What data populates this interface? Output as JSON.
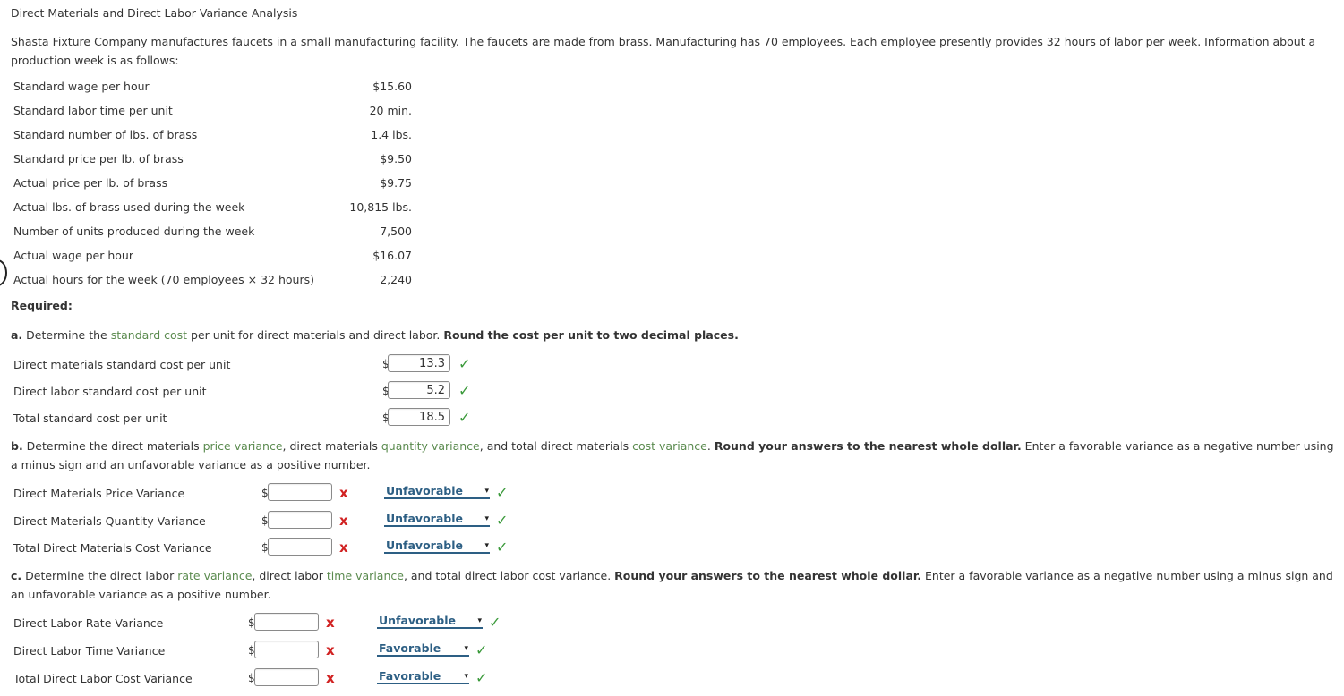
{
  "title": "Direct Materials and Direct Labor Variance Analysis",
  "intro": "Shasta Fixture Company manufactures faucets in a small manufacturing facility. The faucets are made from brass. Manufacturing has 70 employees. Each employee presently provides 32 hours of labor per week. Information about a production week is as follows:",
  "given": [
    {
      "label": "Standard wage per hour",
      "value": "$15.60"
    },
    {
      "label": "Standard labor time per unit",
      "value": "20 min."
    },
    {
      "label": "Standard number of lbs. of brass",
      "value": "1.4 lbs."
    },
    {
      "label": "Standard price per lb. of brass",
      "value": "$9.50"
    },
    {
      "label": "Actual price per lb. of brass",
      "value": "$9.75"
    },
    {
      "label": "Actual lbs. of brass used during the week",
      "value": "10,815 lbs."
    },
    {
      "label": "Number of units produced during the week",
      "value": "7,500"
    },
    {
      "label": "Actual wage per hour",
      "value": "$16.07"
    },
    {
      "label": "Actual hours for the week (70 employees × 32 hours)",
      "value": "2,240"
    }
  ],
  "required_label": "Required:",
  "part_a": {
    "lead": "a.",
    "t1": " Determine the ",
    "kw1": "standard cost",
    "t2": " per unit for direct materials and direct labor. ",
    "bold": "Round the cost per unit to two decimal places.",
    "rows": [
      {
        "label": "Direct materials standard cost per unit",
        "currency": "$",
        "value": "13.3",
        "status": "correct"
      },
      {
        "label": "Direct labor standard cost per unit",
        "currency": "$",
        "value": "5.2",
        "status": "correct"
      },
      {
        "label": "Total standard cost per unit",
        "currency": "$",
        "value": "18.5",
        "status": "correct"
      }
    ]
  },
  "part_b": {
    "lead": "b.",
    "t1": " Determine the direct materials ",
    "kw1": "price variance",
    "t2": ", direct materials ",
    "kw2": "quantity variance",
    "t3": ", and total direct materials ",
    "kw3": "cost variance",
    "t4": ". ",
    "bold": "Round your answers to the nearest whole dollar.",
    "t5": " Enter a favorable variance as a negative number using a minus sign and an unfavorable variance as a positive number.",
    "rows": [
      {
        "label": "Direct Materials Price Variance",
        "currency": "$",
        "value": "",
        "status": "incorrect",
        "select": "Unfavorable",
        "select_status": "correct"
      },
      {
        "label": "Direct Materials Quantity Variance",
        "currency": "$",
        "value": "",
        "status": "incorrect",
        "select": "Unfavorable",
        "select_status": "correct"
      },
      {
        "label": "Total Direct Materials Cost Variance",
        "currency": "$",
        "value": "",
        "status": "incorrect",
        "select": "Unfavorable",
        "select_status": "correct"
      }
    ]
  },
  "part_c": {
    "lead": "c.",
    "t1": " Determine the direct labor ",
    "kw1": "rate variance",
    "t2": ", direct labor ",
    "kw2": "time variance",
    "t3": ", and total direct labor cost variance. ",
    "bold": "Round your answers to the nearest whole dollar.",
    "t4": " Enter a favorable variance as a negative number using a minus sign and an unfavorable variance as a positive number.",
    "rows": [
      {
        "label": "Direct Labor Rate Variance",
        "currency": "$",
        "value": "",
        "status": "incorrect",
        "select": "Unfavorable",
        "select_status": "correct"
      },
      {
        "label": "Direct Labor Time Variance",
        "currency": "$",
        "value": "",
        "status": "incorrect",
        "select": "Favorable",
        "select_status": "correct"
      },
      {
        "label": "Total Direct Labor Cost Variance",
        "currency": "$",
        "value": "",
        "status": "incorrect",
        "select": "Favorable",
        "select_status": "correct"
      }
    ]
  },
  "icons": {
    "check": "✓",
    "cross": "x",
    "caret": "▾"
  }
}
